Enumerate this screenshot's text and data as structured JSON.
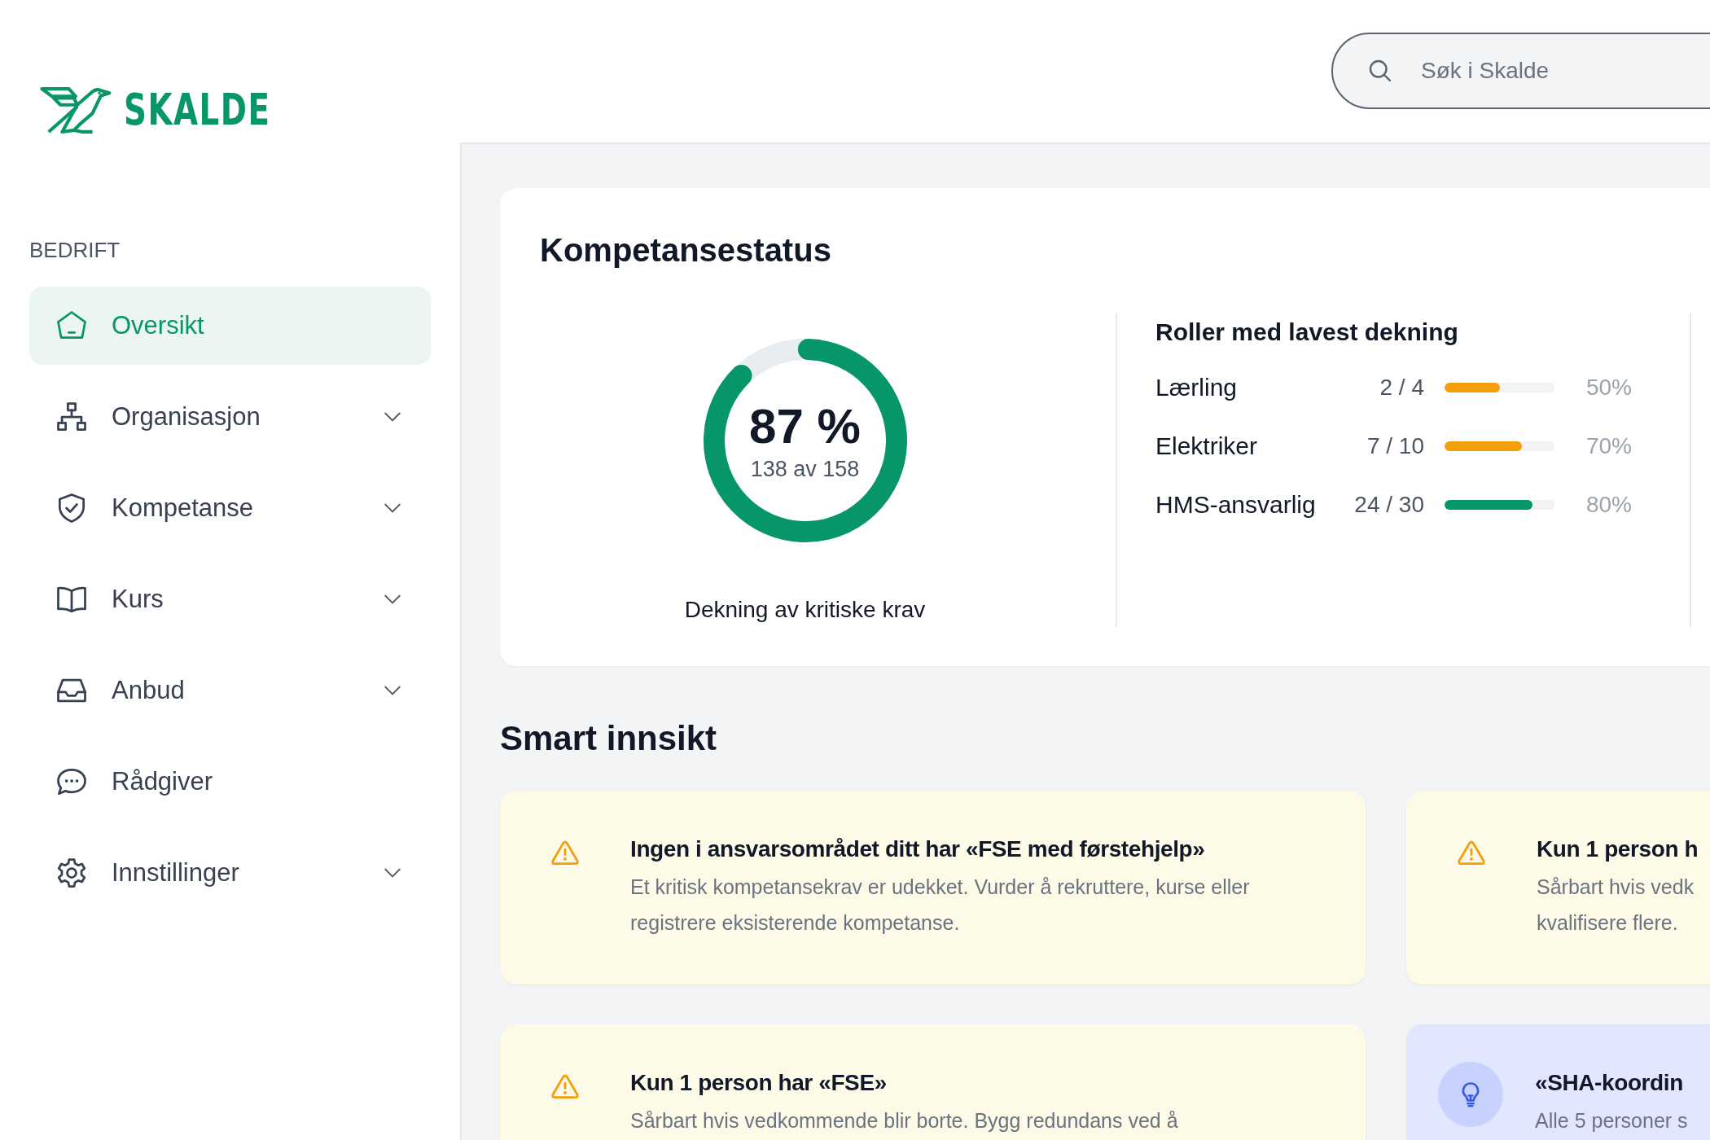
{
  "logo": {
    "text": "SKALDE"
  },
  "search": {
    "placeholder": "Søk i Skalde"
  },
  "sidebar": {
    "section": "BEDRIFT",
    "items": [
      {
        "label": "Oversikt",
        "selected": true,
        "expandable": false
      },
      {
        "label": "Organisasjon",
        "selected": false,
        "expandable": true
      },
      {
        "label": "Kompetanse",
        "selected": false,
        "expandable": true
      },
      {
        "label": "Kurs",
        "selected": false,
        "expandable": true
      },
      {
        "label": "Anbud",
        "selected": false,
        "expandable": true
      },
      {
        "label": "Rådgiver",
        "selected": false,
        "expandable": false
      },
      {
        "label": "Innstillinger",
        "selected": false,
        "expandable": true
      }
    ]
  },
  "status": {
    "title": "Kompetansestatus",
    "coverage": {
      "value": "87 %",
      "detail": "138 av 158",
      "level": 0.87,
      "caption": "Dekning av kritiske krav"
    },
    "roles_title": "Roller med lavest dekning",
    "roles": [
      {
        "name": "Lærling",
        "ratio": "2 / 4",
        "level": 0.5,
        "color": "#f59e0b",
        "percent": "50%"
      },
      {
        "name": "Elektriker",
        "ratio": "7 / 10",
        "level": 0.7,
        "color": "#f59e0b",
        "percent": "70%"
      },
      {
        "name": "HMS-ansvarlig",
        "ratio": "24 / 30",
        "level": 0.8,
        "color": "#059669",
        "percent": "80%"
      }
    ]
  },
  "insights": {
    "title": "Smart innsikt",
    "cards": [
      {
        "kind": "warning",
        "title": "Ingen i ansvarsområdet ditt har «FSE med førstehjelp»",
        "lines": [
          "Et kritisk kompetansekrav er udekket. Vurder å rekruttere, kurse eller",
          "registrere eksisterende kompetanse."
        ]
      },
      {
        "kind": "warning",
        "title": "Kun 1 person h",
        "lines": [
          "Sårbart hvis vedk",
          "kvalifisere flere."
        ]
      },
      {
        "kind": "warning",
        "title": "Kun 1 person har «FSE»",
        "lines": [
          "Sårbart hvis vedkommende blir borte. Bygg redundans ved å"
        ]
      },
      {
        "kind": "tip",
        "title": "«SHA-koordin",
        "lines": [
          "Alle 5 personer s"
        ]
      }
    ]
  }
}
